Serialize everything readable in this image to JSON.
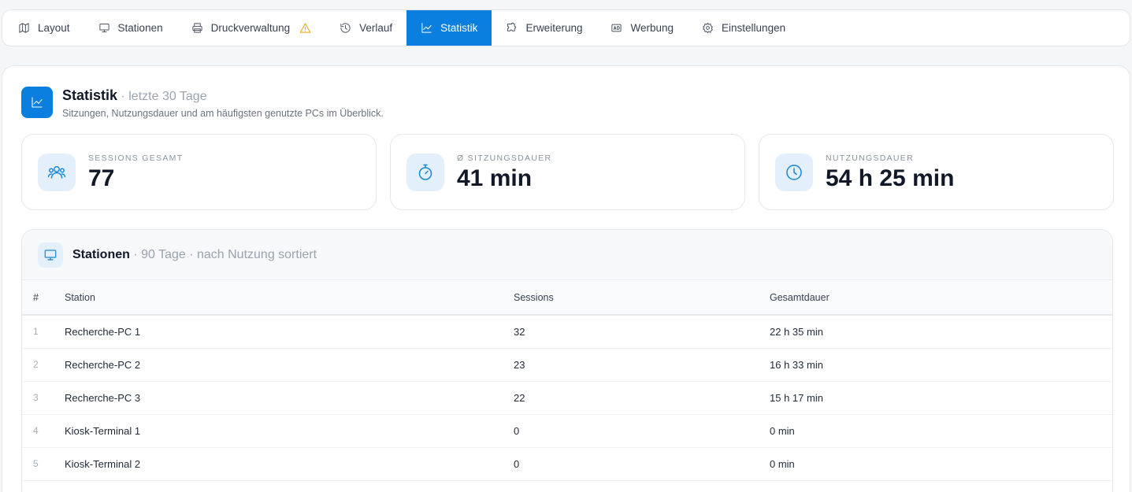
{
  "tabs": [
    {
      "label": "Layout",
      "icon": "map-icon",
      "active": false
    },
    {
      "label": "Stationen",
      "icon": "monitor-icon",
      "active": false
    },
    {
      "label": "Druckverwaltung",
      "icon": "printer-icon",
      "active": false,
      "warning": true
    },
    {
      "label": "Verlauf",
      "icon": "history-icon",
      "active": false
    },
    {
      "label": "Statistik",
      "icon": "chart-icon",
      "active": true
    },
    {
      "label": "Erweiterung",
      "icon": "puzzle-icon",
      "active": false
    },
    {
      "label": "Werbung",
      "icon": "ad-icon",
      "active": false
    },
    {
      "label": "Einstellungen",
      "icon": "gear-icon",
      "active": false
    }
  ],
  "header": {
    "title": "Statistik",
    "title_suffix": " · letzte 30 Tage",
    "subtitle": "Sitzungen, Nutzungsdauer und am häufigsten genutzte PCs im Überblick."
  },
  "kpis": [
    {
      "label": "Sessions gesamt",
      "value": "77",
      "icon": "users-icon"
    },
    {
      "label": "Ø Sitzungsdauer",
      "value": "41 min",
      "icon": "stopwatch-icon"
    },
    {
      "label": "Nutzungsdauer",
      "value": "54 h 25 min",
      "icon": "clock-icon"
    }
  ],
  "stations": {
    "title": "Stationen",
    "title_suffix": " · 90 Tage · nach Nutzung sortiert",
    "columns": [
      "#",
      "Station",
      "Sessions",
      "Gesamtdauer"
    ],
    "rows": [
      {
        "rank": "1",
        "station": "Recherche-PC 1",
        "sessions": "32",
        "duration": "22 h 35 min"
      },
      {
        "rank": "2",
        "station": "Recherche-PC 2",
        "sessions": "23",
        "duration": "16 h 33 min"
      },
      {
        "rank": "3",
        "station": "Recherche-PC 3",
        "sessions": "22",
        "duration": "15 h 17 min"
      },
      {
        "rank": "4",
        "station": "Kiosk-Terminal 1",
        "sessions": "0",
        "duration": "0 min"
      },
      {
        "rank": "5",
        "station": "Kiosk-Terminal 2",
        "sessions": "0",
        "duration": "0 min"
      }
    ]
  },
  "colors": {
    "accent": "#0a7fe0",
    "warning": "#e9a500",
    "icon_bg": "#e3f0fb"
  }
}
